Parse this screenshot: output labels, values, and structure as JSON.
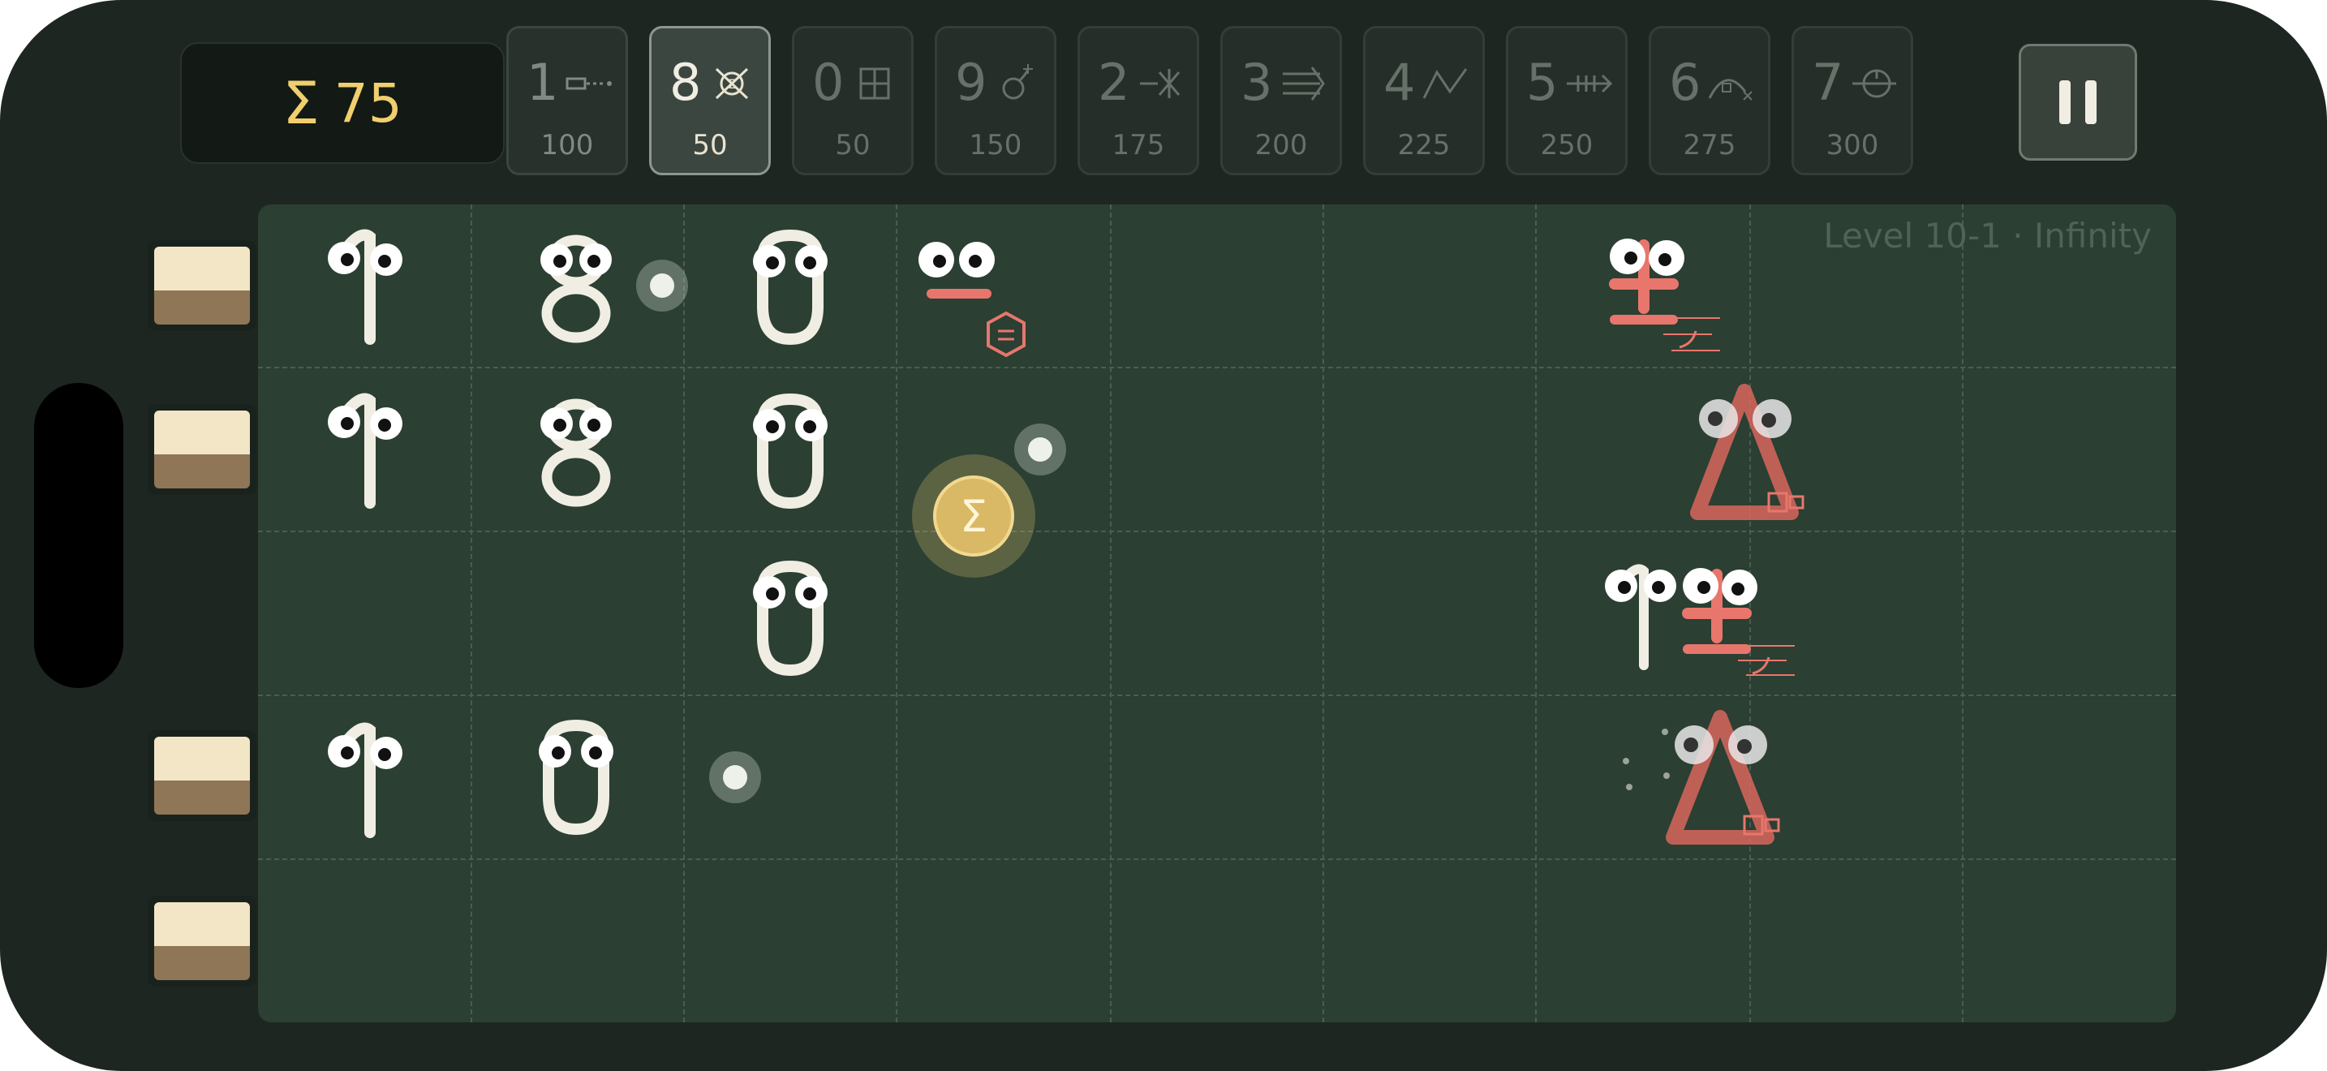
{
  "hud": {
    "sum_symbol": "Σ",
    "sum_value": "75"
  },
  "cards": [
    {
      "digit": "1",
      "cost": "100",
      "icon": "arrow-shot-icon"
    },
    {
      "digit": "8",
      "cost": "50",
      "icon": "sigma-target-icon",
      "selected": true
    },
    {
      "digit": "0",
      "cost": "50",
      "icon": "grid-block-icon"
    },
    {
      "digit": "9",
      "cost": "150",
      "icon": "bomb-spark-icon"
    },
    {
      "digit": "2",
      "cost": "175",
      "icon": "splash-shot-icon"
    },
    {
      "digit": "3",
      "cost": "200",
      "icon": "triple-arrow-icon"
    },
    {
      "digit": "4",
      "cost": "225",
      "icon": "zigzag-icon"
    },
    {
      "digit": "5",
      "cost": "250",
      "icon": "spike-arrow-icon"
    },
    {
      "digit": "6",
      "cost": "275",
      "icon": "arc-bomb-icon"
    },
    {
      "digit": "7",
      "cost": "300",
      "icon": "crosshair-shield-icon"
    }
  ],
  "board": {
    "level_label": "Level 10-1 · Infinity"
  },
  "sigma_pickup": "Σ",
  "colors": {
    "background": "#1d2620",
    "board": "#2b3f33",
    "sum_text": "#f1cf6e",
    "enemy": "#e8766c",
    "digit_chalk": "#f0ede3"
  }
}
